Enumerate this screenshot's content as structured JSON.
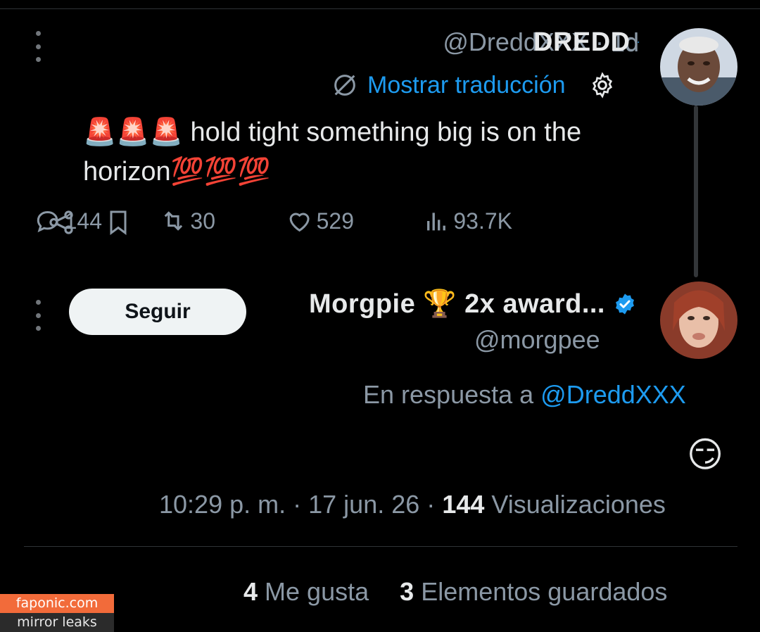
{
  "colors": {
    "background": "#000000",
    "text": "#e7e9ea",
    "muted": "#8b98a5",
    "accent": "#1d9bf0",
    "follow_button_bg": "#eff3f4",
    "watermark_orange": "#f26b3a"
  },
  "parent_tweet": {
    "display_name": "DREDD",
    "handle": "@DreddXXX",
    "separator": "·",
    "age": "1d",
    "translate_label": "Mostrar traducción",
    "text_line1": "🚨🚨🚨 hold tight something big is on the",
    "text_line2": "horizon💯💯💯",
    "stats": {
      "replies": "144",
      "retweets": "30",
      "likes": "529",
      "views": "93.7K"
    },
    "icons": [
      "more-icon",
      "verified-icon",
      "translate-icon",
      "gear-icon",
      "reply-icon",
      "retweet-icon",
      "like-icon",
      "views-icon",
      "bookmark-icon",
      "share-icon"
    ]
  },
  "reply_tweet": {
    "display_name": "Morgpie 🏆 2x award...",
    "handle": "@morgpee",
    "follow_label": "Seguir",
    "in_reply_prefix": "En respuesta a",
    "in_reply_handle": "@DreddXXX",
    "text": "😏",
    "time": "10:29 p. m.",
    "date": "17 jun. 26",
    "separator": "·",
    "views_count": "144",
    "views_label": "Visualizaciones"
  },
  "engagement": {
    "likes_count": "4",
    "likes_label": "Me gusta",
    "saves_count": "3",
    "saves_label": "Elementos guardados"
  },
  "watermark": {
    "site": "faponic.com",
    "tagline": "mirror leaks"
  }
}
